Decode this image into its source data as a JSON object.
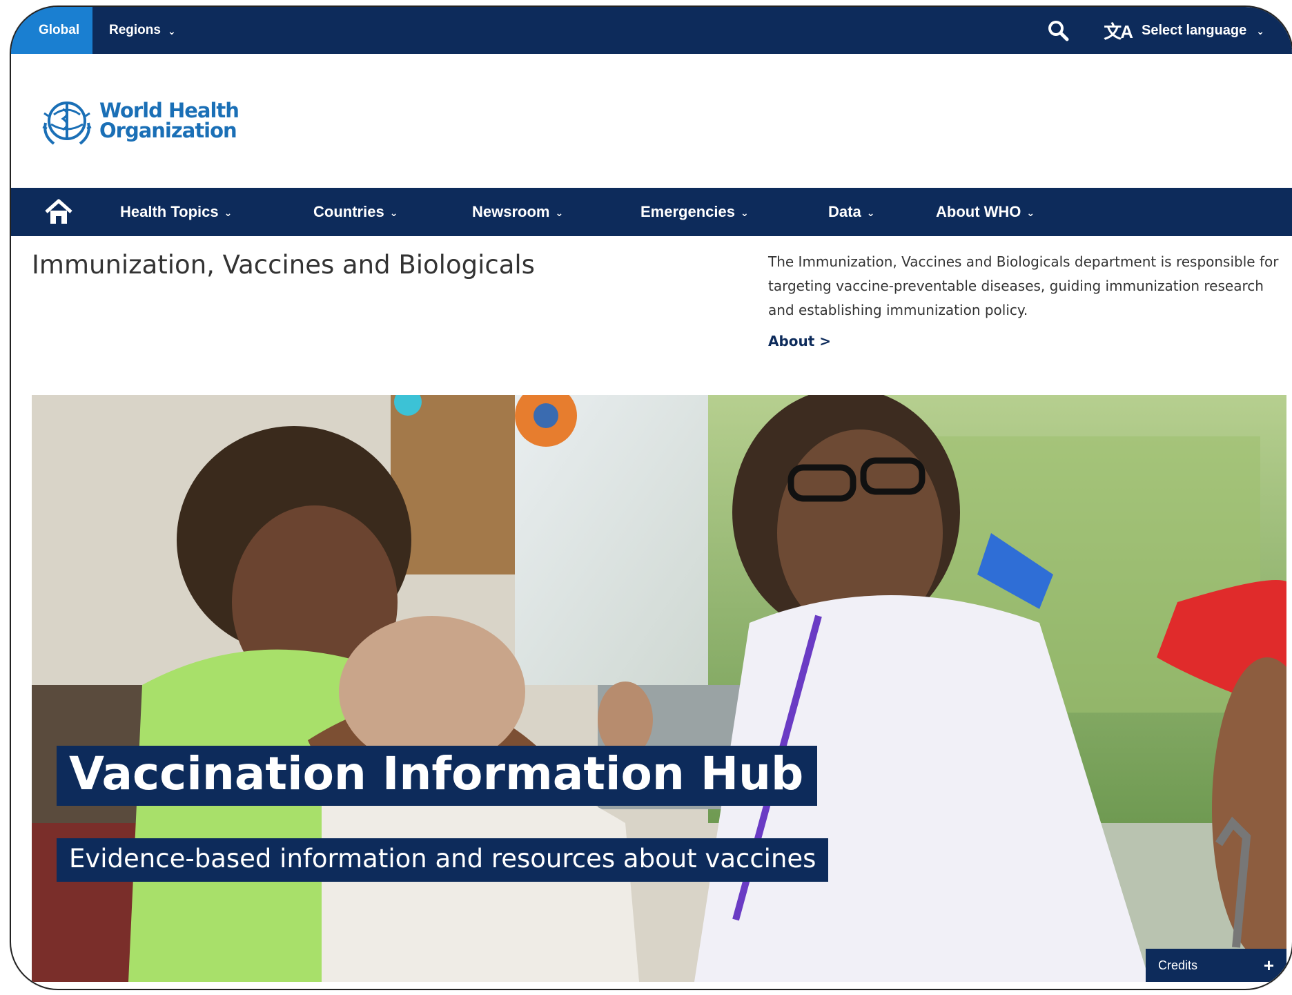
{
  "topbar": {
    "global_label": "Global",
    "regions_label": "Regions",
    "language_label": "Select language",
    "language_icon": "translate-icon",
    "search_icon": "search-icon"
  },
  "logo": {
    "line1": "World Health",
    "line2": "Organization",
    "emblem_icon": "who-emblem-icon"
  },
  "nav": {
    "home_icon": "home-icon",
    "items": [
      {
        "label": "Health Topics"
      },
      {
        "label": "Countries"
      },
      {
        "label": "Newsroom"
      },
      {
        "label": "Emergencies"
      },
      {
        "label": "Data"
      },
      {
        "label": "About WHO"
      }
    ]
  },
  "department": {
    "title": "Immunization, Vaccines and Biologicals",
    "description": "The Immunization, Vaccines and Biologicals department is responsible for targeting vaccine-preventable diseases, guiding immunization research and establishing immunization policy.",
    "about_link": "About >"
  },
  "hero": {
    "title": "Vaccination Information Hub",
    "subtitle": "Evidence-based information and resources about vaccines",
    "credits_label": "Credits",
    "credits_icon": "+"
  },
  "colors": {
    "navy": "#0d2b5b",
    "global_tab": "#1a7fd1",
    "logo_blue": "#1a6fb6"
  }
}
